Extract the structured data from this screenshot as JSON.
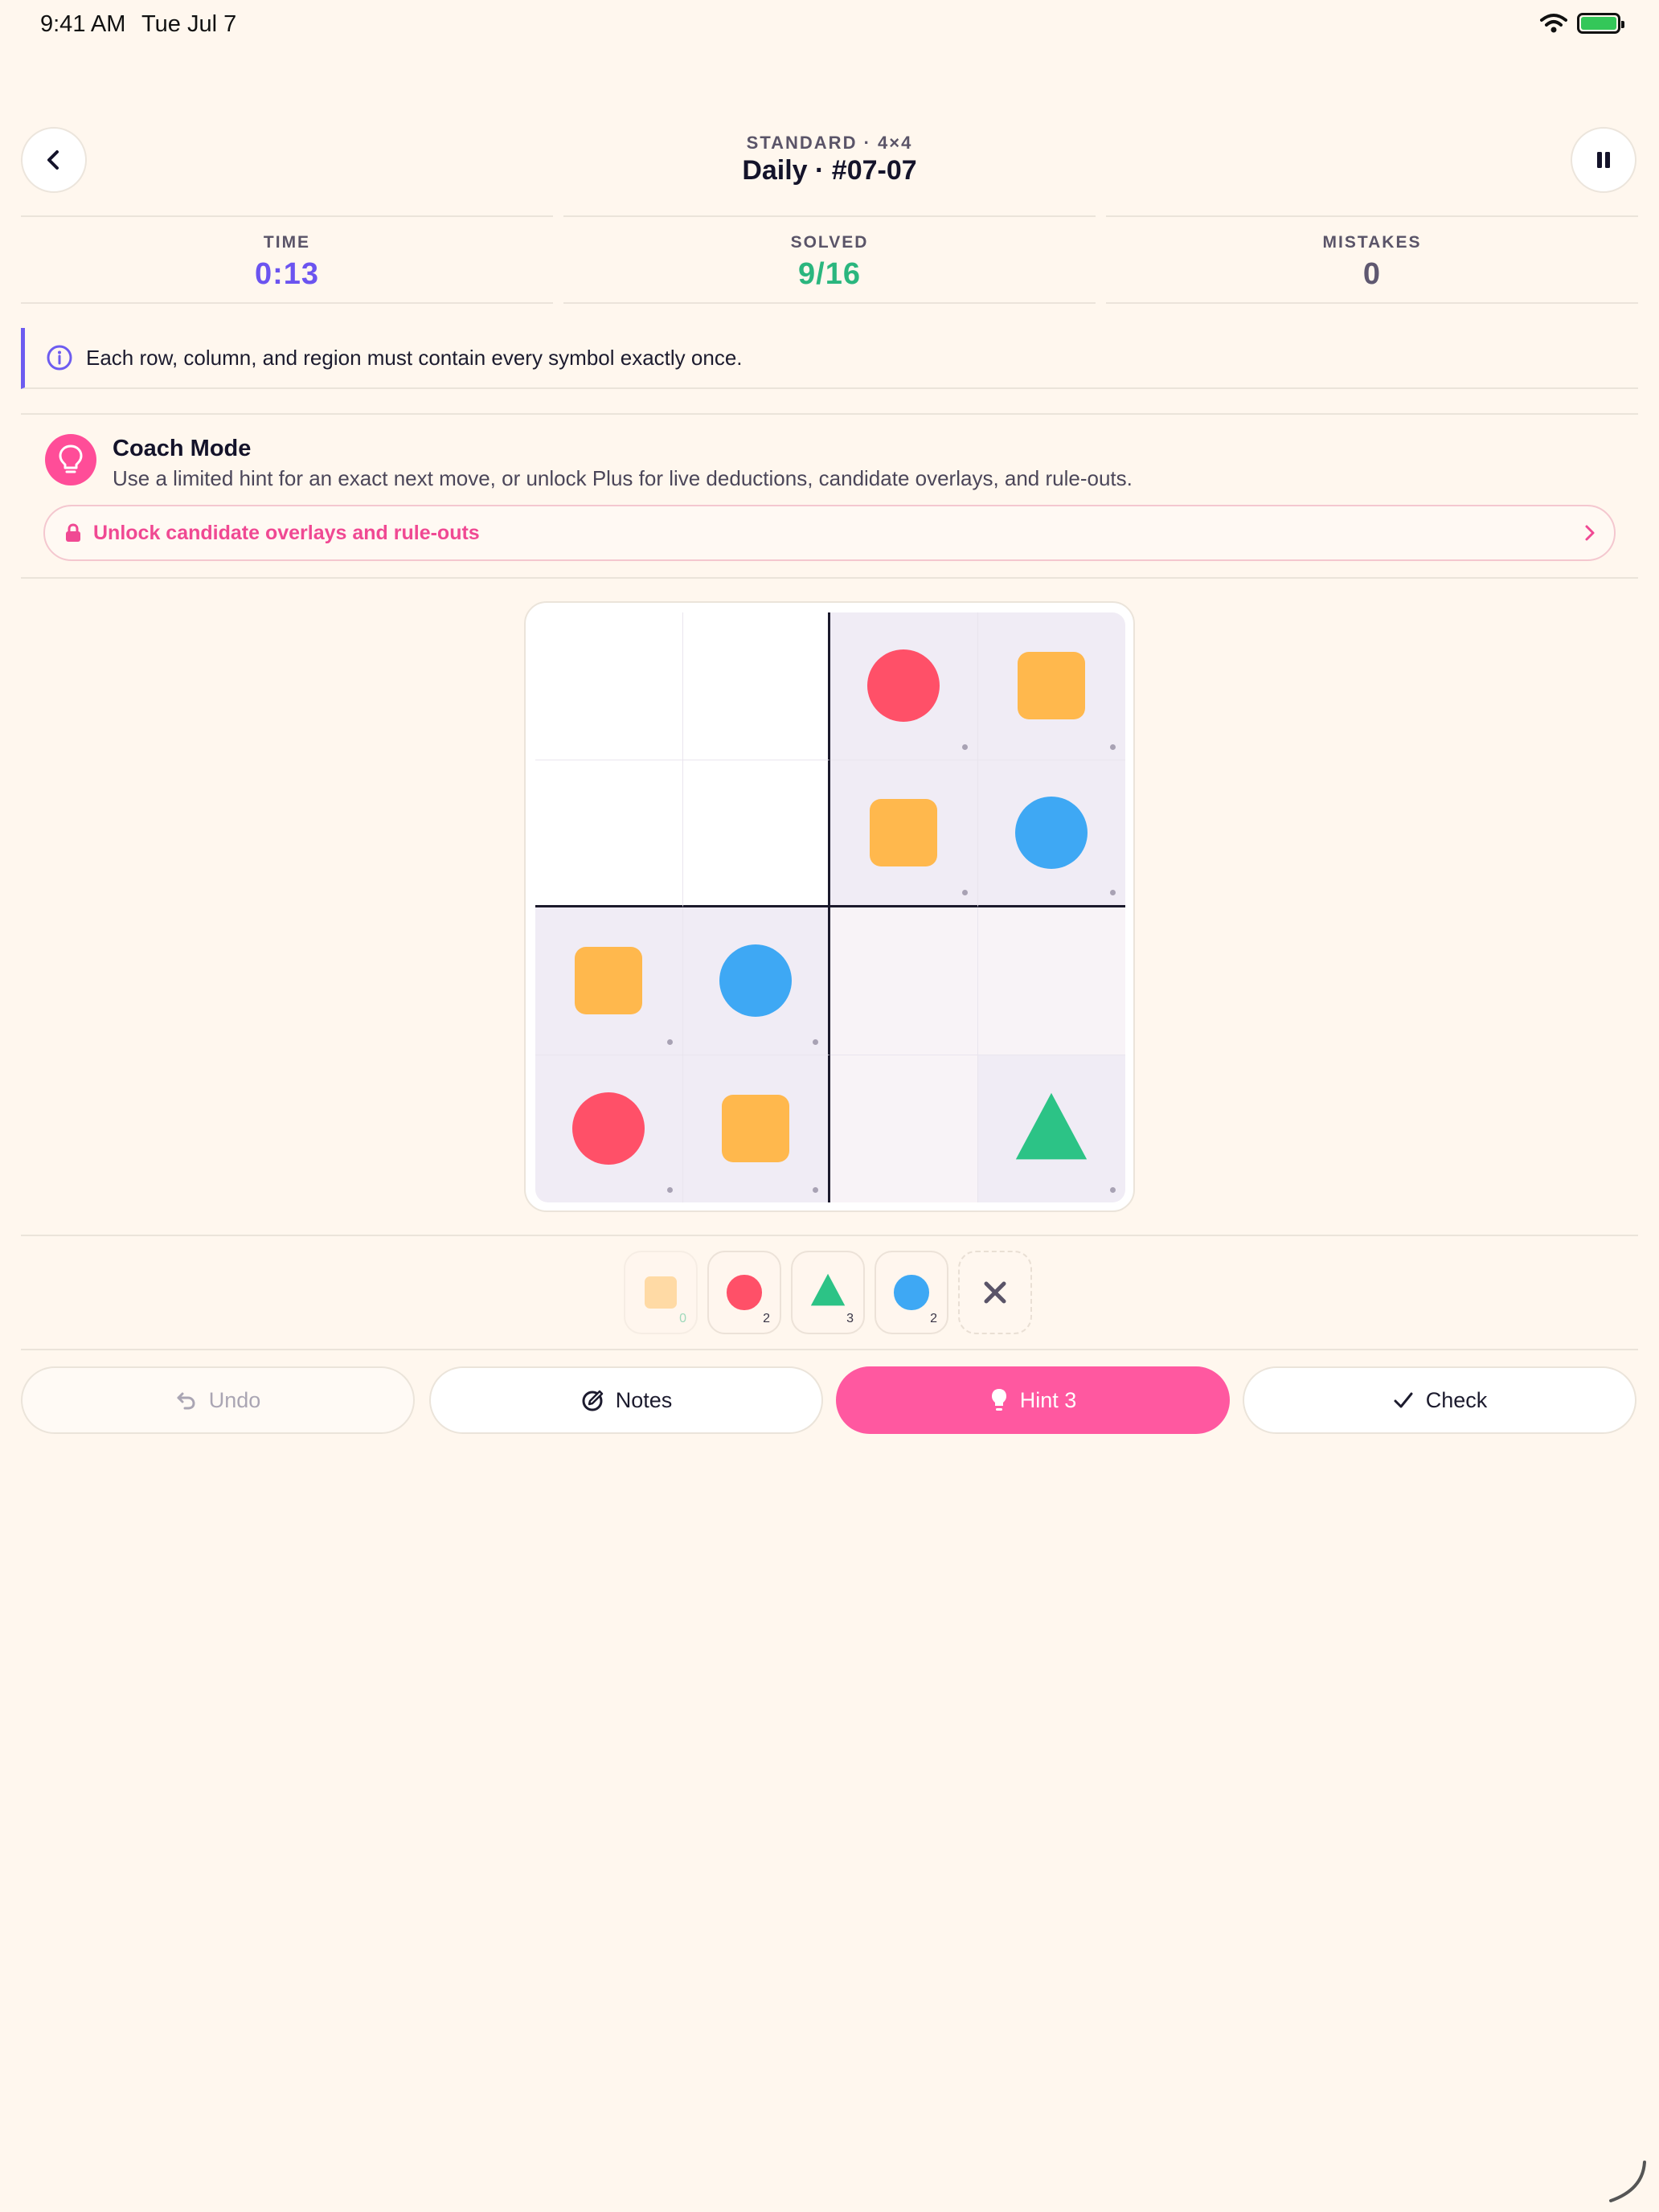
{
  "status_bar": {
    "time": "9:41 AM",
    "date": "Tue Jul 7",
    "icons": [
      "wifi-icon",
      "battery-charging-icon"
    ]
  },
  "header": {
    "subtitle": "STANDARD · 4×4",
    "title": "Daily · #07-07",
    "back_icon": "chevron-left-icon",
    "pause_icon": "pause-icon"
  },
  "stats": {
    "time": {
      "label": "TIME",
      "value": "0:13",
      "color": "#6b54f0"
    },
    "solved": {
      "label": "SOLVED",
      "value": "9/16",
      "color": "#2ab67e"
    },
    "mistakes": {
      "label": "MISTAKES",
      "value": "0",
      "color": "#5f5870"
    }
  },
  "rule": {
    "icon": "info-icon",
    "text": "Each row, column, and region must contain every symbol exactly once."
  },
  "coach": {
    "icon": "lightbulb-icon",
    "title": "Coach Mode",
    "description": "Use a limited hint for an exact next move, or unlock Plus for live deductions, candidate overlays, and rule-outs.",
    "unlock_label": "Unlock candidate overlays and rule-outs",
    "unlock_icons": [
      "lock-icon",
      "chevron-right-icon"
    ]
  },
  "board": {
    "size": 4,
    "cells": [
      [
        null,
        null,
        "circle-red",
        "square-orange"
      ],
      [
        null,
        null,
        "square-orange",
        "circle-blue"
      ],
      [
        "square-orange",
        "circle-blue",
        null,
        null
      ],
      [
        "circle-red",
        "square-orange",
        null,
        "triangle-green"
      ]
    ],
    "given": [
      [
        false,
        false,
        true,
        true
      ],
      [
        false,
        false,
        true,
        true
      ],
      [
        true,
        true,
        false,
        false
      ],
      [
        true,
        true,
        false,
        true
      ]
    ]
  },
  "symbols": {
    "circle-red": "#ff5068",
    "circle-blue": "#3ea8f4",
    "square-orange": "#ffb84d",
    "triangle-green": "#2cc386"
  },
  "palette": [
    {
      "symbol": "square-orange",
      "count": "0"
    },
    {
      "symbol": "circle-red",
      "count": "2"
    },
    {
      "symbol": "triangle-green",
      "count": "3"
    },
    {
      "symbol": "circle-blue",
      "count": "2"
    },
    {
      "symbol": "erase",
      "icon": "close-icon"
    }
  ],
  "actions": {
    "undo": "Undo",
    "notes": "Notes",
    "hint": "Hint 3",
    "check": "Check"
  }
}
